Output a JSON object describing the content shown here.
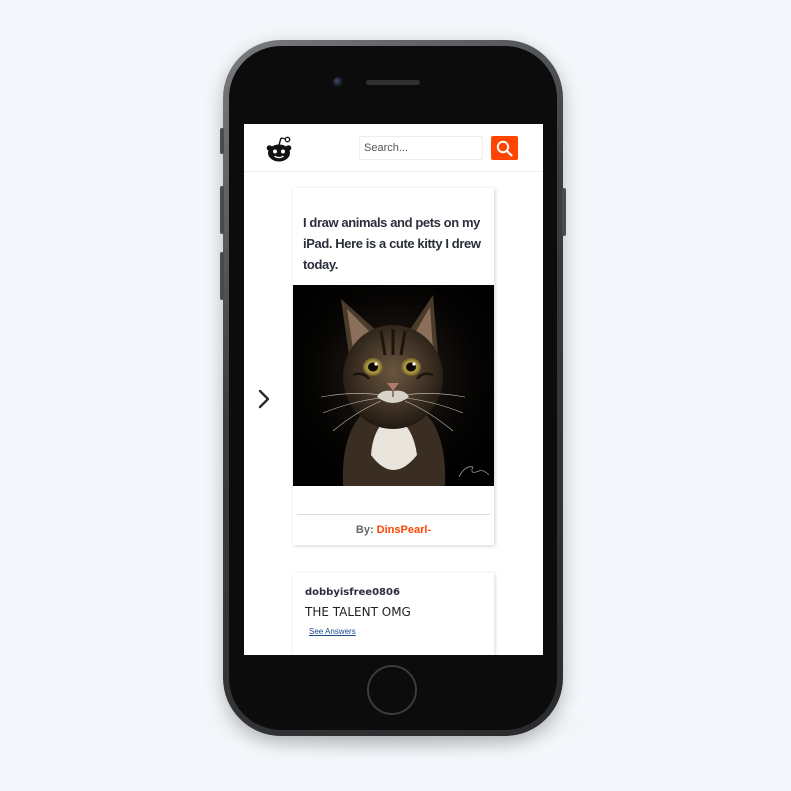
{
  "header": {
    "logo_icon": "reddit-alien-icon",
    "search": {
      "placeholder": "Search...",
      "value": "",
      "button_icon": "search-icon"
    }
  },
  "carousel": {
    "next_icon": "chevron-right-icon"
  },
  "post": {
    "title": "I draw animals and pets on my iPad. Here is a cute kitty I drew today.",
    "image_subject": "digital painting of a tabby cat on a black background",
    "byline_prefix": "By: ",
    "author": "DinsPearl-"
  },
  "comments": [
    {
      "username": "dobbyisfree0806",
      "text": "THE TALENT OMG",
      "answers_link": "See Answers"
    }
  ],
  "colors": {
    "accent": "#ff4500",
    "page_background": "#f3f6fa",
    "link": "#1a4a8a"
  }
}
